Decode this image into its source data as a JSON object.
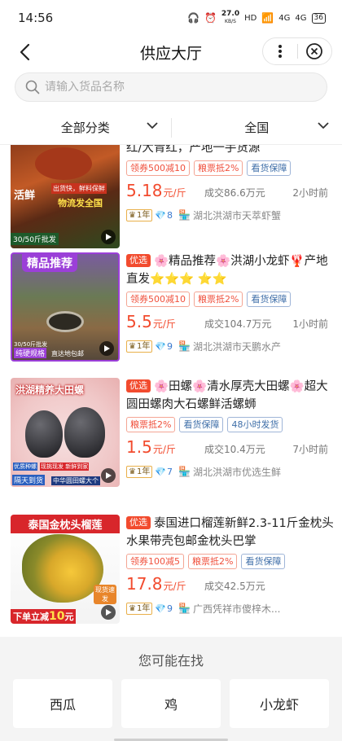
{
  "status": {
    "time": "14:56",
    "speed_value": "27.0",
    "speed_unit": "KB/S",
    "network_hd": "HD",
    "network_4g_a": "4G",
    "network_4g_b": "4G",
    "battery": "36"
  },
  "nav": {
    "title": "供应大厅"
  },
  "search": {
    "placeholder": "请输入货品名称"
  },
  "filters": {
    "category": "全部分类",
    "region": "全国"
  },
  "products": [
    {
      "badge": "",
      "title": "红/大青红，产地一手货源",
      "image_caption_top": "",
      "image_caption_a": "活鲜",
      "image_caption_b": "出货快，鲜料保鲜",
      "image_caption_c": "物流发全国",
      "image_caption_d": "30/50斤批发",
      "tags": [
        {
          "text": "领券500减10",
          "style": "red"
        },
        {
          "text": "粮票抵2%",
          "style": "red"
        },
        {
          "text": "看货保障",
          "style": "blue"
        }
      ],
      "price": "5.18",
      "unit": "元/斤",
      "volume": "成交86.6万元",
      "time": "2小时前",
      "year_badge": "1年",
      "level": "8",
      "location": "湖北洪湖市天萃虾蟹"
    },
    {
      "badge": "优选",
      "title": "🌸精品推荐🌸洪湖小龙虾🦞产地直发⭐⭐⭐ ⭐⭐",
      "image_caption_top": "精品推荐",
      "image_caption_a": "30/50斤批发",
      "image_caption_b": "纯硬规格",
      "image_caption_c": "直达地包邮",
      "image_caption_d": "货源保障",
      "tags": [
        {
          "text": "领券500减10",
          "style": "red"
        },
        {
          "text": "粮票抵2%",
          "style": "red"
        },
        {
          "text": "看货保障",
          "style": "blue"
        }
      ],
      "price": "5.5",
      "unit": "元/斤",
      "volume": "成交104.7万元",
      "time": "1小时前",
      "year_badge": "1年",
      "level": "9",
      "location": "湖北洪湖市天鹏水产"
    },
    {
      "badge": "优选",
      "title": "🌸田螺🌸清水厚壳大田螺🌸超大圆田螺肉大石螺鲜活螺蛳",
      "image_caption_top": "洪湖精养大田螺",
      "image_caption_a": "优质种螺",
      "image_caption_b": "现挑现发 新鲜到家",
      "image_caption_c": "隔天到货",
      "image_caption_d": "中华圆田螺大个",
      "tags": [
        {
          "text": "粮票抵2%",
          "style": "red"
        },
        {
          "text": "看货保障",
          "style": "blue"
        },
        {
          "text": "48小时发货",
          "style": "blue"
        }
      ],
      "price": "1.5",
      "unit": "元/斤",
      "volume": "成交10.4万元",
      "time": "7小时前",
      "year_badge": "1年",
      "level": "7",
      "location": "湖北洪湖市优选生鲜"
    },
    {
      "badge": "优选",
      "title": "泰国进口榴莲新鲜2.3-11斤金枕头水果带壳包邮金枕头巴掌",
      "image_caption_top": "泰国金枕头榴莲",
      "image_caption_a": "下单立减",
      "image_caption_b": "10",
      "image_caption_c": "元",
      "image_caption_d": "现货速发",
      "tags": [
        {
          "text": "领券100减5",
          "style": "red"
        },
        {
          "text": "粮票抵2%",
          "style": "red"
        },
        {
          "text": "看货保障",
          "style": "blue"
        }
      ],
      "price": "17.8",
      "unit": "元/斤",
      "volume": "成交42.5万元",
      "time": "",
      "year_badge": "1年",
      "level": "9",
      "location": "广西凭祥市傻梓木..."
    }
  ],
  "maybe": {
    "title": "您可能在找",
    "chips": [
      "西瓜",
      "鸡",
      "小龙虾"
    ]
  }
}
